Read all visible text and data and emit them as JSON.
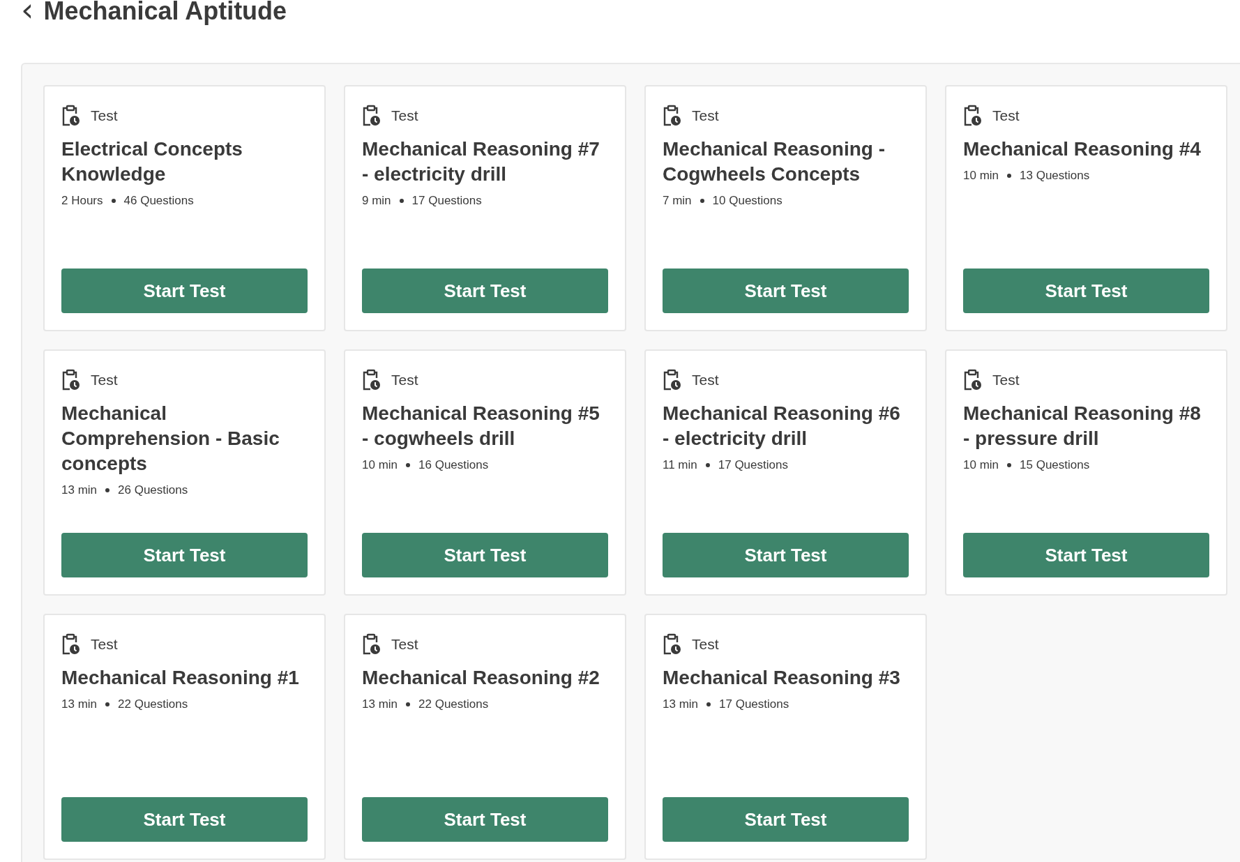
{
  "header": {
    "back": "‹",
    "title": "Mechanical Aptitude"
  },
  "tests": [
    {
      "type": "Test",
      "title": "Electrical Concepts Knowledge",
      "duration": "2 Hours",
      "questions": "46 Questions",
      "button": "Start Test"
    },
    {
      "type": "Test",
      "title": "Mechanical Reasoning #7 - electricity drill",
      "duration": "9 min",
      "questions": "17 Questions",
      "button": "Start Test"
    },
    {
      "type": "Test",
      "title": "Mechanical Reasoning - Cogwheels Concepts",
      "duration": "7 min",
      "questions": "10 Questions",
      "button": "Start Test"
    },
    {
      "type": "Test",
      "title": "Mechanical Reasoning #4",
      "duration": "10 min",
      "questions": "13 Questions",
      "button": "Start Test"
    },
    {
      "type": "Test",
      "title": "Mechanical Comprehension - Basic concepts",
      "duration": "13 min",
      "questions": "26 Questions",
      "button": "Start Test"
    },
    {
      "type": "Test",
      "title": "Mechanical Reasoning #5 - cogwheels drill",
      "duration": "10 min",
      "questions": "16 Questions",
      "button": "Start Test"
    },
    {
      "type": "Test",
      "title": "Mechanical Reasoning #6 - electricity drill",
      "duration": "11 min",
      "questions": "17 Questions",
      "button": "Start Test"
    },
    {
      "type": "Test",
      "title": "Mechanical Reasoning #8 - pressure drill",
      "duration": "10 min",
      "questions": "15 Questions",
      "button": "Start Test"
    },
    {
      "type": "Test",
      "title": "Mechanical Reasoning #1",
      "duration": "13 min",
      "questions": "22 Questions",
      "button": "Start Test"
    },
    {
      "type": "Test",
      "title": "Mechanical Reasoning #2",
      "duration": "13 min",
      "questions": "22 Questions",
      "button": "Start Test"
    },
    {
      "type": "Test",
      "title": "Mechanical Reasoning #3",
      "duration": "13 min",
      "questions": "17 Questions",
      "button": "Start Test"
    }
  ]
}
